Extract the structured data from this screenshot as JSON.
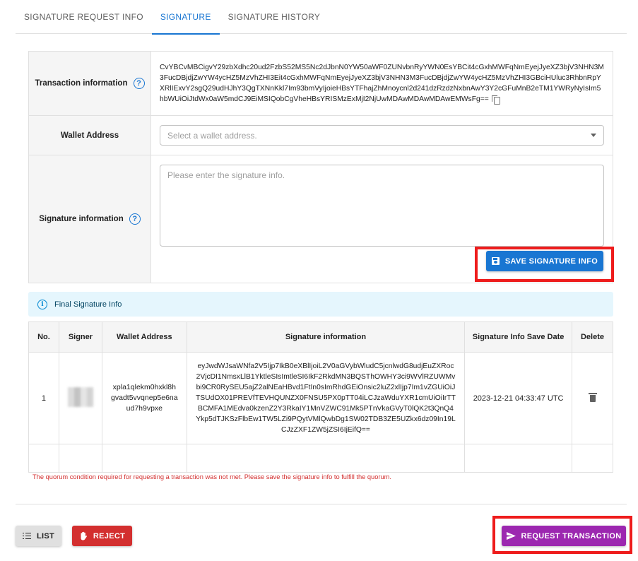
{
  "tabs": [
    {
      "label": "SIGNATURE REQUEST INFO"
    },
    {
      "label": "SIGNATURE"
    },
    {
      "label": "SIGNATURE HISTORY"
    }
  ],
  "active_tab": "SIGNATURE",
  "form": {
    "transaction_label": "Transaction information",
    "transaction_value": "CvYBCvMBCigvY29zbXdhc20ud2FzbS52MS5Nc2dJbnN0YW50aWF0ZUNvbnRyYWN0EsYBCit4cGxhMWFqNmEyejJyeXZ3bjV3NHN3M3FucDBjdjZwYW4ycHZ5MzVhZHI3Eit4cGxhMWFqNmEyejJyeXZ3bjV3NHN3M3FucDBjdjZwYW4ycHZ5MzVhZHI3GBciHUluc3RhbnRpYXRlIExvY2sgQ29udHJhY3QgTXNnKkl7Im93bmVyIjoieHBsYTFhajZhMnoycnl2d241dzRzdzNxbnAwY3Y2cGFuMnB2eTM1YWRyNyIsIm5hbWUiOiJtdWx0aW5mdCJ9EiMSIQobCgVheHBsYRISMzExMjI2NjUwMDAwMDAwMDAwEMWsFg==",
    "wallet_label": "Wallet Address",
    "wallet_placeholder": "Select a wallet address.",
    "signature_label": "Signature information",
    "signature_placeholder": "Please enter the signature info.",
    "save_button": "SAVE SIGNATURE INFO"
  },
  "alert": {
    "text": "Final Signature Info"
  },
  "table": {
    "headers": [
      "No.",
      "Signer",
      "Wallet Address",
      "Signature information",
      "Signature Info Save Date",
      "Delete"
    ],
    "row1": {
      "no": "1",
      "wallet": "xpla1qlekm0hxkl8hgvadt5vvqnep5e6naud7h9vpxe",
      "signature": "eyJwdWJsaWNfa2V5Ijp7IkB0eXBlIjoiL2V0aGVybWludC5jcnlwdG8udjEuZXRoc2VjcDI1NmsxLlB1YktleSIsImtleSI6IkF2RkdMN3BQSThOWHY3ci9WVlRZUWMvbi9CR0RySEU5ajZ2alNEaHBvd1FtIn0sImRhdGEiOnsic2luZ2xlIjp7Im1vZGUiOiJTSUdOX01PREVfTEVHQUNZX0FNSU5PX0pTT04iLCJzaWduYXR1cmUiOiIrTTBCMFA1MEdva0kzenZ2Y3RkaIY1MnVZWC91Mk5PTnVkaGVyT0lQK2t3QnQ4Ykp5dTJKSzFlbEw1TW5LZi9PQytVMlQwbDg1SW02TDB3ZE5UZkx6dz09In19LCJzZXF1ZW5jZSI6IjEifQ==",
      "date": "2023-12-21 04:33:47 UTC",
      "row2": {
        "no": "-",
        "signer": "-",
        "wallet": "-",
        "signature": "-",
        "date": "-",
        "delete": "-"
      }
    }
  },
  "error_text": "The quorum condition required for requesting a transaction was not met. Please save the signature info to fulfill the quorum.",
  "footer": {
    "list_button": "LIST",
    "reject_button": "REJECT",
    "request_button": "REQUEST TRANSACTION"
  },
  "colors": {
    "primary": "#1976d2",
    "reject": "#d32f2f",
    "request": "#9c27b0",
    "highlight_box": "#ee1c1c"
  }
}
